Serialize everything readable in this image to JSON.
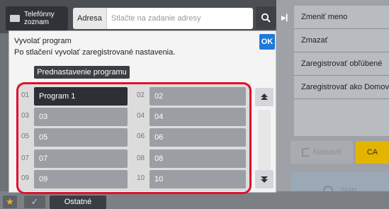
{
  "topbar": {
    "contacts_label_line1": "Telefónny",
    "contacts_label_line2": "zoznam",
    "address_label": "Adresa",
    "address_placeholder": "Stlačte na zadanie adresy"
  },
  "dialog": {
    "title": "Vyvolať program",
    "description": "Po stlačení vyvolať zaregistrované nastavenia.",
    "ok_label": "OK",
    "preset_label": "Prednastavenie programu",
    "programs": [
      {
        "num": "01",
        "label": "Program 1",
        "selected": true
      },
      {
        "num": "02",
        "label": "02",
        "selected": false
      },
      {
        "num": "03",
        "label": "03",
        "selected": false
      },
      {
        "num": "04",
        "label": "04",
        "selected": false
      },
      {
        "num": "05",
        "label": "05",
        "selected": false
      },
      {
        "num": "06",
        "label": "06",
        "selected": false
      },
      {
        "num": "07",
        "label": "07",
        "selected": false
      },
      {
        "num": "08",
        "label": "08",
        "selected": false
      },
      {
        "num": "09",
        "label": "09",
        "selected": false
      },
      {
        "num": "10",
        "label": "10",
        "selected": false
      }
    ]
  },
  "right_panel": {
    "menu": [
      "Zmeniť meno",
      "Zmazať",
      "Zaregistrovať obľúbené",
      "Zaregistrovať ako Domov"
    ],
    "nastavit_label": "Nastaviť",
    "ca_label": "CA",
    "start_label": "Start"
  },
  "bottombar": {
    "other_label": "Ostatné"
  },
  "colors": {
    "highlight": "#e0102a",
    "ok_button": "#1e7ad8",
    "ca_button": "#e3b500"
  }
}
